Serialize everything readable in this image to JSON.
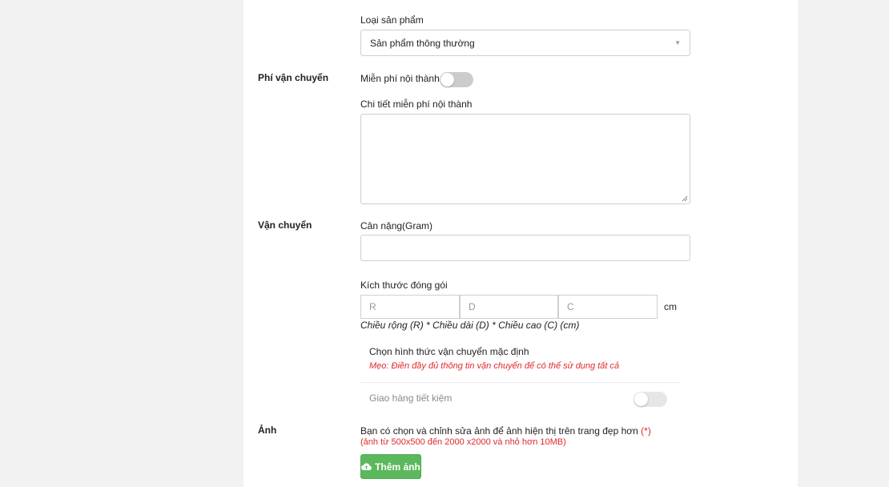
{
  "product_type": {
    "label": "Loại sản phẩm",
    "selected": "Sản phẩm thông thường"
  },
  "shipping_fee": {
    "section": "Phí vận chuyển",
    "free_inner_city_label": "Miễn phí nội thành:",
    "free_inner_city_enabled": false,
    "detail_label": "Chi tiết miễn phí nội thành",
    "detail_value": ""
  },
  "shipping": {
    "section": "Vận chuyển",
    "weight_label": "Cân nặng(Gram)",
    "weight_value": "",
    "package_size_label": "Kích thước đóng gói",
    "width_placeholder": "R",
    "length_placeholder": "D",
    "height_placeholder": "C",
    "unit": "cm",
    "size_hint": "Chiều rộng (R) * Chiều dài (D) * Chiều cao (C) (cm)",
    "default_method_title": "Chọn hình thức vận chuyển mặc định",
    "default_method_tip": "Mẹo: Điền đầy đủ thông tin vận chuyển để có thể sử dụng tất cả",
    "methods": [
      {
        "name": "Giao hàng tiết kiệm",
        "enabled": false
      }
    ]
  },
  "images": {
    "section": "Ảnh",
    "description": "Bạn có chọn và chỉnh sửa ảnh để ảnh hiện thị trên trang đẹp hơn",
    "required_mark": "(*)",
    "size_note": "(ảnh từ 500x500 đến 2000 x2000 và nhỏ hơn 10MB)",
    "add_button": "Thêm ảnh"
  },
  "colors": {
    "accent_green": "#5cb85c",
    "warning_red": "#e0292b",
    "toggle_off": "#cccccc"
  }
}
